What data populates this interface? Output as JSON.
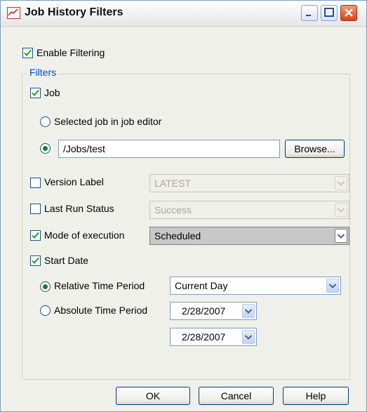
{
  "window": {
    "title": "Job History Filters"
  },
  "enable_filtering": {
    "label": "Enable Filtering",
    "checked": true
  },
  "filters_group": {
    "legend": "Filters"
  },
  "job": {
    "label": "Job",
    "checked": true,
    "option_selected_job": "Selected job in job editor",
    "path_value": "/Jobs/test",
    "browse_label": "Browse..."
  },
  "version_label": {
    "label": "Version Label",
    "checked": false,
    "value": "LATEST"
  },
  "last_run_status": {
    "label": "Last Run Status",
    "checked": false,
    "value": "Success"
  },
  "mode_of_execution": {
    "label": "Mode of execution",
    "checked": true,
    "value": "Scheduled"
  },
  "start_date": {
    "label": "Start Date",
    "checked": true,
    "relative_label": "Relative Time Period",
    "relative_value": "Current Day",
    "absolute_label": "Absolute Time Period",
    "absolute_from": "2/28/2007",
    "absolute_to": "2/28/2007"
  },
  "buttons": {
    "ok": "OK",
    "cancel": "Cancel",
    "help": "Help"
  },
  "icons": {
    "app": "chart-icon",
    "minimize": "minimize-icon",
    "maximize": "maximize-icon",
    "close": "close-icon",
    "check": "check-icon",
    "dropdown": "chevron-down-icon"
  },
  "colors": {
    "accent_text": "#0046d5",
    "radio_dot": "#1b7a28",
    "close_button": "#d64314"
  }
}
